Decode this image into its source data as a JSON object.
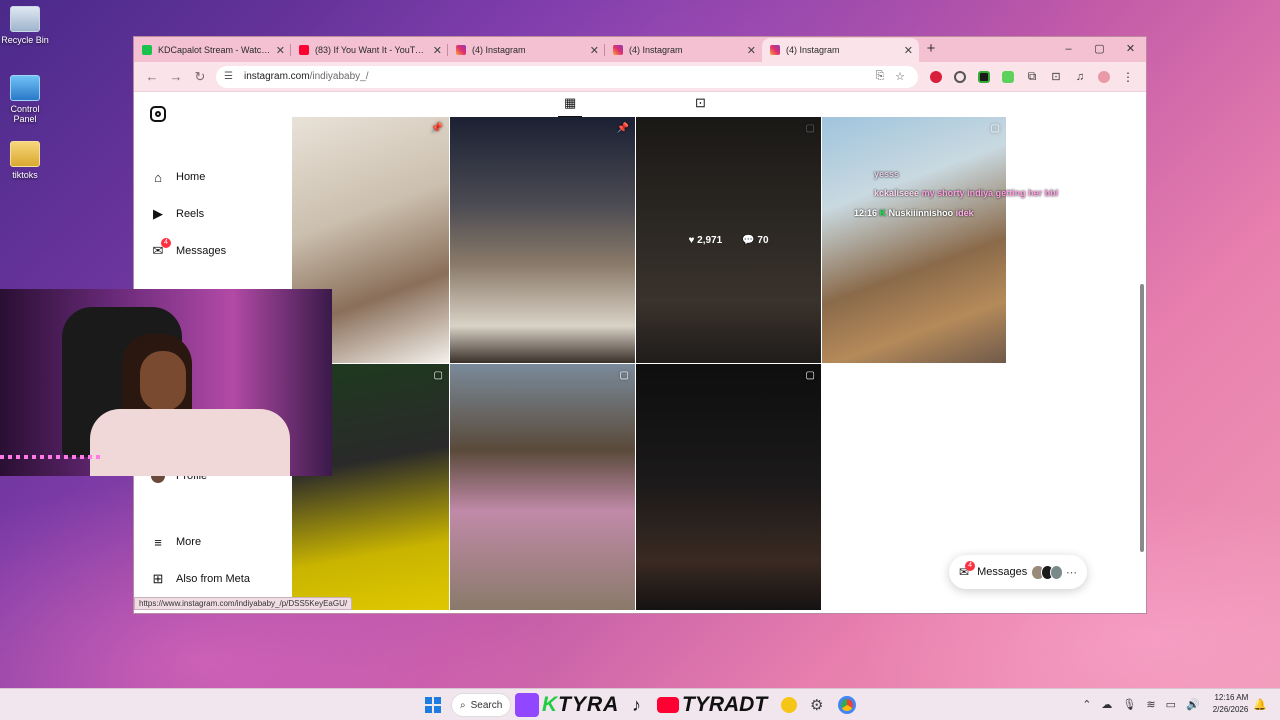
{
  "desktop": {
    "icons": [
      {
        "label": "Recycle Bin"
      },
      {
        "label": "Control Panel"
      },
      {
        "label": "tiktoks"
      }
    ]
  },
  "browser": {
    "tabs": [
      {
        "title": "KDCapalot Stream - Watch Live",
        "icon": "twitch-icon"
      },
      {
        "title": "(83) If You Want It - YouTube",
        "icon": "youtube-icon"
      },
      {
        "title": "(4) Instagram",
        "icon": "instagram-icon"
      },
      {
        "title": "(4) Instagram",
        "icon": "instagram-icon"
      },
      {
        "title": "(4) Instagram",
        "icon": "instagram-icon"
      }
    ],
    "new_tab": "+",
    "controls": {
      "minimize": "–",
      "maximize": "▢",
      "close": "✕"
    },
    "url_host": "instagram.com",
    "url_path": "/indiyababy_/",
    "status_url": "https://www.instagram.com/indiyababy_/p/DSS5KeyEaGU/"
  },
  "instagram": {
    "nav": [
      {
        "label": "Home",
        "icon": "home-icon"
      },
      {
        "label": "Reels",
        "icon": "reels-icon"
      },
      {
        "label": "Messages",
        "icon": "messages-icon",
        "badge": "4"
      },
      {
        "label": "Profile",
        "icon": "avatar"
      },
      {
        "label": "More",
        "icon": "menu-icon"
      },
      {
        "label": "Also from Meta",
        "icon": "meta-icon"
      }
    ],
    "hover_post": {
      "likes": "2,971",
      "comments": "70"
    },
    "messages_pill": {
      "label": "Messages",
      "badge": "4"
    }
  },
  "chat_overlay": [
    {
      "user": "",
      "text": "yesss"
    },
    {
      "user": "kckaliseee",
      "text": "my shorty indiya getting her bbl"
    },
    {
      "time": "12:16",
      "user": "Nuskiiinnishoo",
      "text": "idek"
    }
  ],
  "taskbar": {
    "search": "Search",
    "brand_1": "TYRA",
    "brand_2": "TYRADT",
    "time": "12:16 AM",
    "date": "2/26/2026"
  },
  "colors": {
    "tab_bar": "#f4c1d2",
    "toolbar": "#fbe3ea",
    "badge": "#ff3040"
  }
}
